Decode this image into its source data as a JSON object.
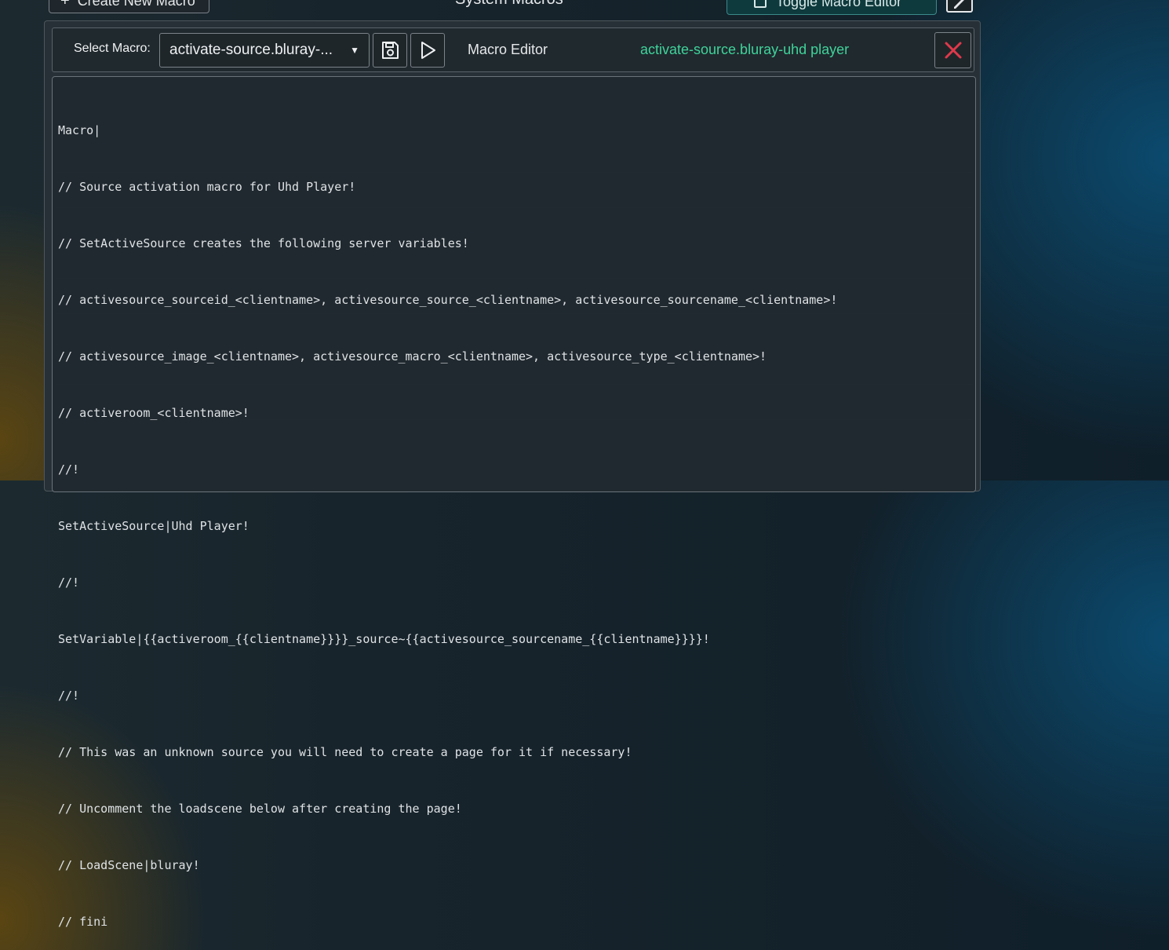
{
  "header": {
    "create_label": "Create New Macro",
    "title": "System Macros",
    "toggle_label": "Toggle Macro Editor"
  },
  "toolbar": {
    "select_label": "Select Macro:",
    "selected_macro": "activate-source.bluray-...",
    "editor_label": "Macro Editor",
    "macro_name": "activate-source.bluray-uhd player"
  },
  "editor": {
    "lines": [
      "Macro|",
      "// Source activation macro for Uhd Player!",
      "// SetActiveSource creates the following server variables!",
      "// activesource_sourceid_<clientname>, activesource_source_<clientname>, activesource_sourcename_<clientname>!",
      "// activesource_image_<clientname>, activesource_macro_<clientname>, activesource_type_<clientname>!",
      "// activeroom_<clientname>!",
      "//!",
      "SetActiveSource|Uhd Player!",
      "//!",
      "SetVariable|{{activeroom_{{clientname}}}}_source~{{activesource_sourcename_{{clientname}}}}!",
      "//!",
      "// This was an unknown source you will need to create a page for it if necessary!",
      "// Uncomment the loadscene below after creating the page!",
      "// LoadScene|bluray!",
      "// fini"
    ]
  },
  "colors": {
    "accent_green": "#3fd39a",
    "close_red": "#e0394a"
  }
}
